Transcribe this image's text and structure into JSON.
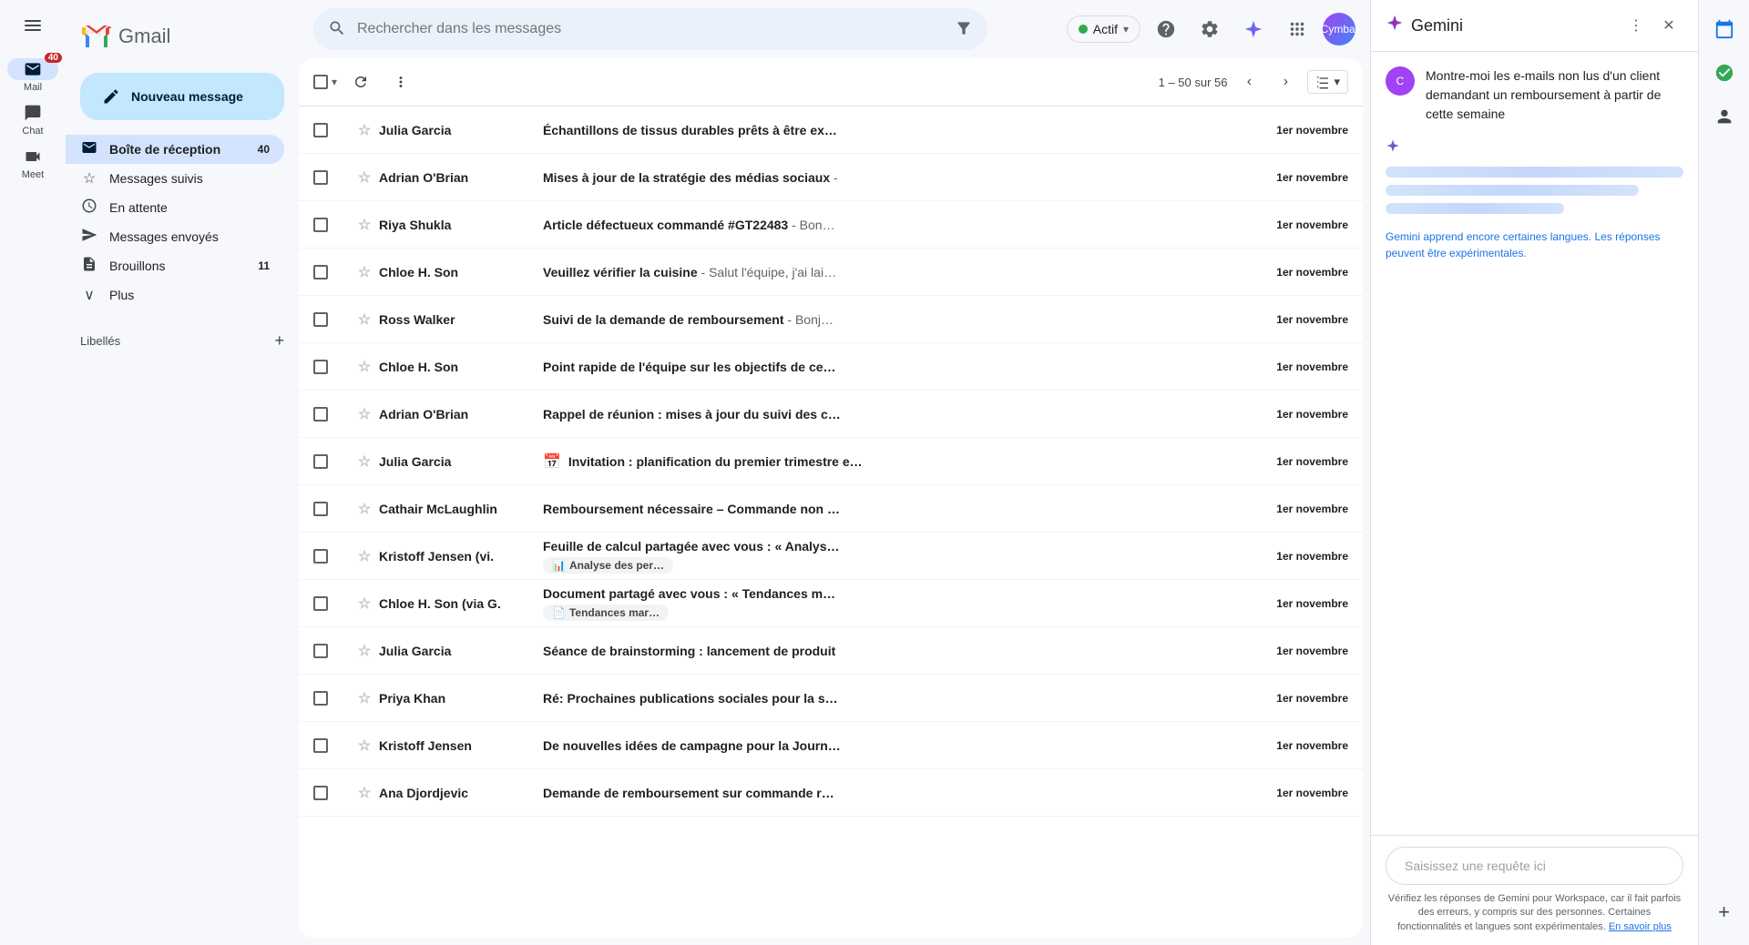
{
  "app": {
    "title": "Gmail",
    "brand": "Cymbal"
  },
  "header": {
    "search_placeholder": "Rechercher dans les messages",
    "status_label": "Actif",
    "menu_icon": "☰"
  },
  "sidebar": {
    "compose_label": "Nouveau message",
    "nav_items": [
      {
        "id": "mail",
        "label": "Mail",
        "icon": "✉",
        "badge": "40",
        "active": false
      },
      {
        "id": "chat",
        "label": "Chat",
        "icon": "💬",
        "badge": "",
        "active": false
      },
      {
        "id": "meet",
        "label": "Meet",
        "icon": "📹",
        "badge": "",
        "active": false
      }
    ],
    "inbox_label": "Boîte de réception",
    "inbox_badge": "40",
    "starred_label": "Messages suivis",
    "snoozed_label": "En attente",
    "sent_label": "Messages envoyés",
    "drafts_label": "Brouillons",
    "drafts_badge": "11",
    "more_label": "Plus",
    "labels_section": "Libellés"
  },
  "email_list": {
    "toolbar": {
      "pagination_text": "1 – 50 sur 56"
    },
    "emails": [
      {
        "id": 1,
        "sender": "Julia Garcia",
        "subject": "Échantillons de tissus durables prêts à être ex…",
        "snippet": "",
        "date": "1er novembre",
        "unread": true,
        "starred": false,
        "has_attachment": false,
        "has_calendar": false,
        "chips": []
      },
      {
        "id": 2,
        "sender": "Adrian O'Brian",
        "subject": "Mises à jour de la stratégie des médias sociaux",
        "snippet": " -",
        "date": "1er novembre",
        "unread": true,
        "starred": false,
        "has_attachment": false,
        "has_calendar": false,
        "chips": []
      },
      {
        "id": 3,
        "sender": "Riya Shukla",
        "subject": "Article défectueux commandé #GT22483",
        "snippet": " - Bon…",
        "date": "1er novembre",
        "unread": true,
        "starred": false,
        "has_attachment": false,
        "has_calendar": false,
        "chips": []
      },
      {
        "id": 4,
        "sender": "Chloe H. Son",
        "subject": "Veuillez vérifier la cuisine",
        "snippet": " - Salut l'équipe, j'ai lai…",
        "date": "1er novembre",
        "unread": true,
        "starred": false,
        "has_attachment": false,
        "has_calendar": false,
        "chips": []
      },
      {
        "id": 5,
        "sender": "Ross Walker",
        "subject": "Suivi de la demande de remboursement",
        "snippet": " - Bonj…",
        "date": "1er novembre",
        "unread": true,
        "starred": false,
        "has_attachment": false,
        "has_calendar": false,
        "chips": []
      },
      {
        "id": 6,
        "sender": "Chloe H. Son",
        "subject": "Point rapide de l'équipe sur les objectifs de ce…",
        "snippet": "",
        "date": "1er novembre",
        "unread": true,
        "starred": false,
        "has_attachment": false,
        "has_calendar": false,
        "chips": []
      },
      {
        "id": 7,
        "sender": "Adrian O'Brian",
        "subject": "Rappel de réunion : mises à jour du suivi des c…",
        "snippet": "",
        "date": "1er novembre",
        "unread": true,
        "starred": false,
        "has_attachment": false,
        "has_calendar": false,
        "chips": []
      },
      {
        "id": 8,
        "sender": "Julia Garcia",
        "subject": "Invitation : planification du premier trimestre e…",
        "snippet": "",
        "date": "1er novembre",
        "unread": true,
        "starred": false,
        "has_attachment": false,
        "has_calendar": true,
        "chips": []
      },
      {
        "id": 9,
        "sender": "Cathair McLaughlin",
        "subject": "Remboursement nécessaire – Commande non …",
        "snippet": "",
        "date": "1er novembre",
        "unread": true,
        "starred": false,
        "has_attachment": false,
        "has_calendar": false,
        "chips": []
      },
      {
        "id": 10,
        "sender": "Kristoff Jensen (vi.",
        "subject": "Feuille de calcul partagée avec vous : « Analys…",
        "snippet": "",
        "date": "1er novembre",
        "unread": true,
        "starred": false,
        "has_attachment": false,
        "has_calendar": false,
        "chips": [
          {
            "icon": "📊",
            "label": "Analyse des per…",
            "color": "#137333"
          }
        ]
      },
      {
        "id": 11,
        "sender": "Chloe H. Son (via G.",
        "subject": "Document partagé avec vous : « Tendances m…",
        "snippet": "",
        "date": "1er novembre",
        "unread": true,
        "starred": false,
        "has_attachment": false,
        "has_calendar": false,
        "chips": [
          {
            "icon": "📄",
            "label": "Tendances mar…",
            "color": "#1a73e8"
          }
        ]
      },
      {
        "id": 12,
        "sender": "Julia Garcia",
        "subject": "Séance de brainstorming : lancement de produit",
        "snippet": "",
        "date": "1er novembre",
        "unread": true,
        "starred": false,
        "has_attachment": false,
        "has_calendar": false,
        "chips": []
      },
      {
        "id": 13,
        "sender": "Priya Khan",
        "subject": "Ré: Prochaines publications sociales pour la s…",
        "snippet": "",
        "date": "1er novembre",
        "unread": true,
        "starred": false,
        "has_attachment": false,
        "has_calendar": false,
        "chips": []
      },
      {
        "id": 14,
        "sender": "Kristoff Jensen",
        "subject": "De nouvelles idées de campagne pour la Journ…",
        "snippet": "",
        "date": "1er novembre",
        "unread": true,
        "starred": false,
        "has_attachment": false,
        "has_calendar": false,
        "chips": []
      },
      {
        "id": 15,
        "sender": "Ana Djordjevic",
        "subject": "Demande de remboursement sur commande r…",
        "snippet": "",
        "date": "1er novembre",
        "unread": true,
        "starred": false,
        "has_attachment": false,
        "has_calendar": false,
        "chips": []
      }
    ]
  },
  "gemini": {
    "title": "Gemini",
    "user_query": "Montre-moi les e-mails non lus d'un client demandant un remboursement à partir de cette semaine",
    "note_text": "Gemini apprend encore certaines langues. Les réponses peuvent être expérimentales.",
    "input_placeholder": "Saisissez une requête ici",
    "disclaimer": "Vérifiez les réponses de Gemini pour Workspace, car il fait parfois des erreurs, y compris sur des personnes. Certaines fonctionnalités et langues sont expérimentales.",
    "learn_more": "En savoir plus"
  }
}
